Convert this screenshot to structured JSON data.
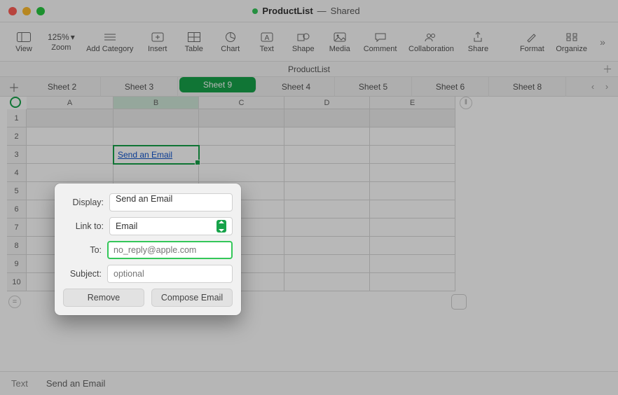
{
  "window": {
    "doc_name": "ProductList",
    "shared_label": "Shared"
  },
  "toolbar": {
    "view": "View",
    "zoom_label": "Zoom",
    "zoom_value": "125%",
    "add_category": "Add Category",
    "insert": "Insert",
    "table": "Table",
    "chart": "Chart",
    "text": "Text",
    "shape": "Shape",
    "media": "Media",
    "comment": "Comment",
    "collaboration": "Collaboration",
    "share": "Share",
    "format": "Format",
    "organize": "Organize"
  },
  "doc_tab": {
    "name": "ProductList"
  },
  "sheets": {
    "tabs": [
      "Sheet 2",
      "Sheet 3",
      "Sheet 9",
      "Sheet 4",
      "Sheet 5",
      "Sheet 6",
      "Sheet 8"
    ],
    "active_index": 2
  },
  "grid": {
    "columns": [
      "A",
      "B",
      "C",
      "D",
      "E"
    ],
    "rows": [
      "1",
      "2",
      "3",
      "4",
      "5",
      "6",
      "7",
      "8",
      "9",
      "10"
    ],
    "selected_cell": "B3",
    "selected_cell_value": "Send an Email"
  },
  "popover": {
    "display_label": "Display:",
    "display_value": "Send an Email",
    "linkto_label": "Link to:",
    "linkto_value": "Email",
    "to_label": "To:",
    "to_placeholder": "no_reply@apple.com",
    "to_value": "",
    "subject_label": "Subject:",
    "subject_placeholder": "optional",
    "subject_value": "",
    "remove_btn": "Remove",
    "compose_btn": "Compose Email"
  },
  "bottombar": {
    "mode": "Text",
    "value": "Send an Email"
  },
  "colors": {
    "accent": "#17a34a"
  }
}
